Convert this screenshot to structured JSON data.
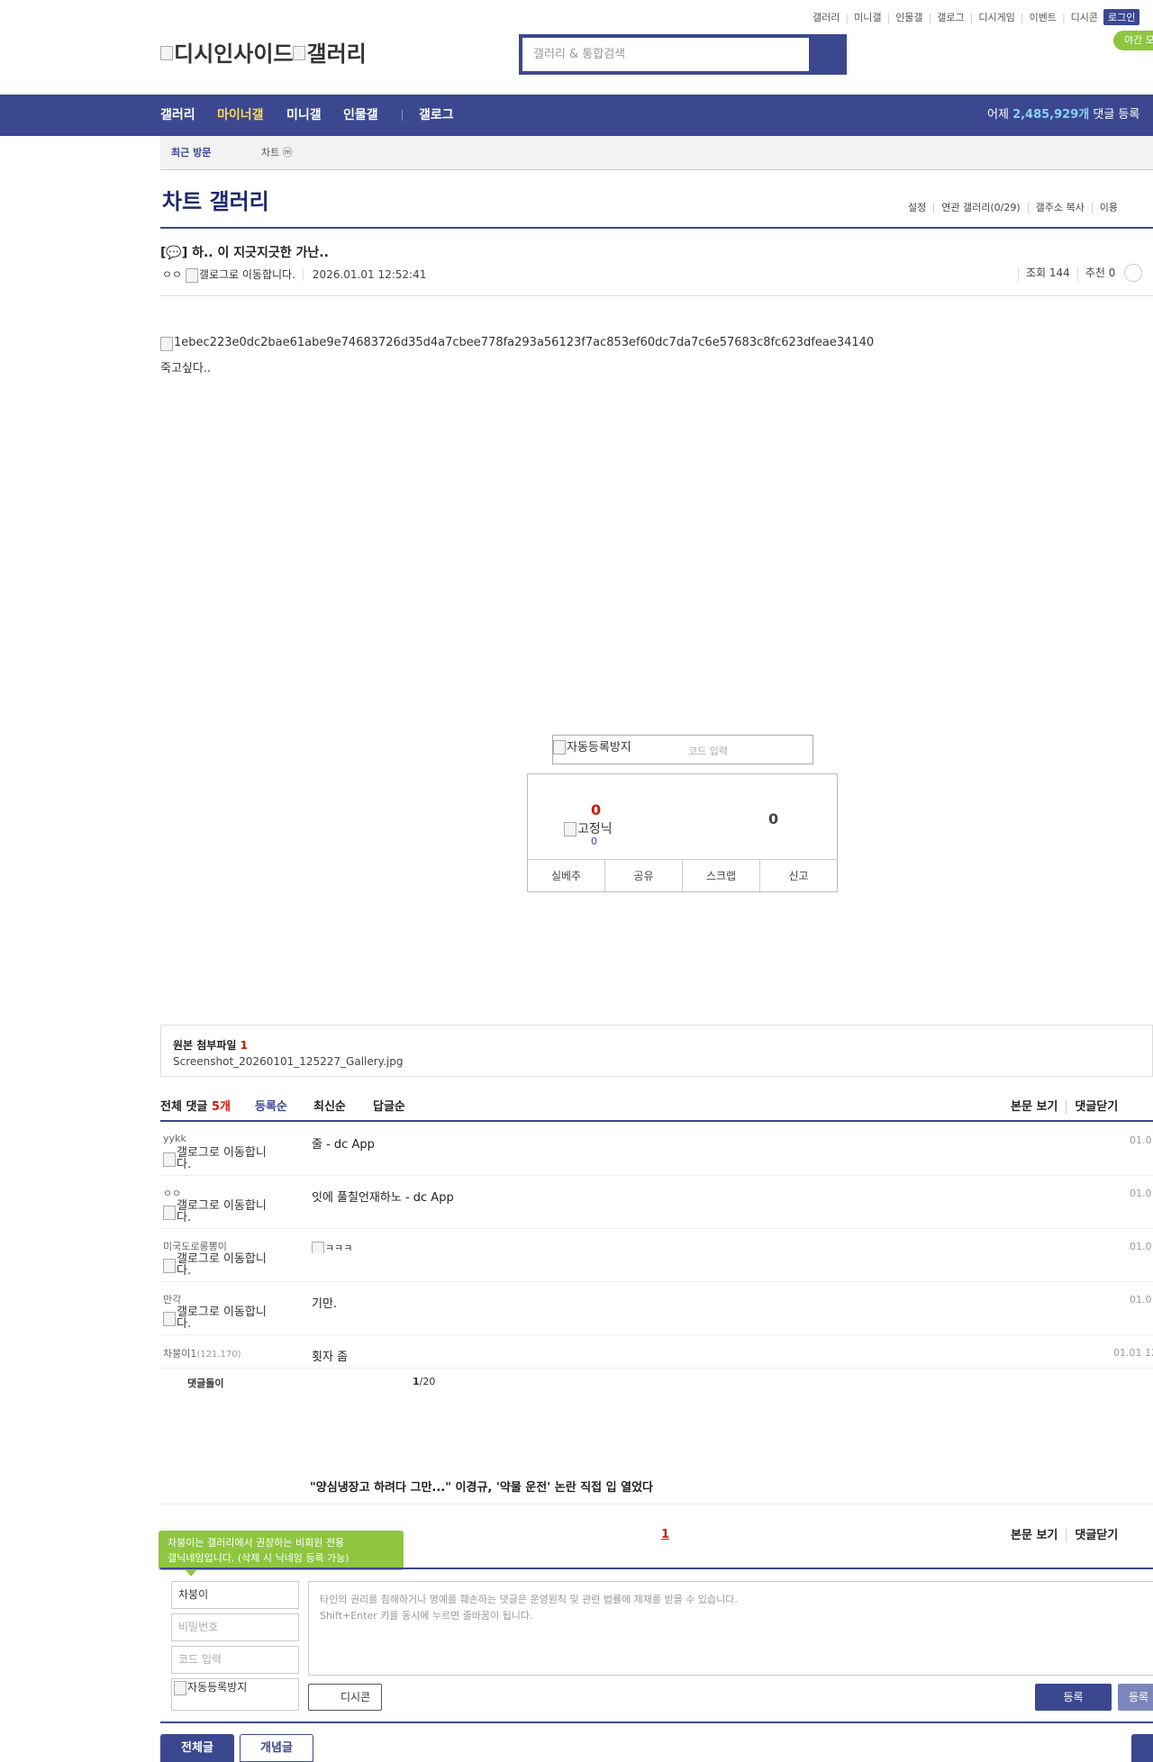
{
  "top_menu": [
    "갤러리",
    "미니갤",
    "인물갤",
    "갤로그",
    "디시게임",
    "이벤트",
    "디시콘"
  ],
  "login_label": "로그인",
  "night_mode_label": "야간 모",
  "logo_alt": "디시인사이드",
  "logo_alt2": "갤러리",
  "search_placeholder": "갤러리 & 통합검색",
  "gnb": {
    "items": [
      "갤러리",
      "마이너갤",
      "미니갤",
      "인물갤",
      "갤로그"
    ],
    "stat_prefix": "어제",
    "stat_value": "2,485,929개",
    "stat_suffix": "댓글 등록"
  },
  "recent": {
    "label": "최근 방문",
    "item": "차트 ⓜ"
  },
  "gallery": {
    "title": "차트 갤러리",
    "menu": [
      "설정",
      "연관 갤러리(0/29)",
      "갤주소 복사",
      "이용"
    ]
  },
  "post": {
    "title": "[💬] 하.. 이 지긋지긋한 가난..",
    "author": "ㅇㅇ",
    "author_icon_alt": "갤로그로 이동합니다.",
    "date": "2026.01.01 12:52:41",
    "views": "조회 144",
    "recommends": "추천 0",
    "image_alt": "1ebec223e0dc2bae61abe9e74683726d35d4a7cbee778fa293a56123f7ac853ef60dc7da7c6e57683c8fc623dfeae34140",
    "body": "죽고싶다.."
  },
  "captcha": {
    "img_alt": "자동등록방지",
    "placeholder": "코드 입력"
  },
  "recommend_box": {
    "up": "0",
    "fixed_alt": "고정닉",
    "fixed_count": "0",
    "down": "0",
    "buttons": [
      "실베추",
      "공유",
      "스크랩",
      "신고"
    ]
  },
  "attachment": {
    "label": "원본 첨부파일",
    "count": "1",
    "file": "Screenshot_20260101_125227_Gallery.jpg"
  },
  "comments": {
    "total_label": "전체 댓글",
    "total_count": "5개",
    "sort": [
      "등록순",
      "최신순",
      "답글순"
    ],
    "right_links": [
      "본문 보기",
      "댓글닫기"
    ],
    "items": [
      {
        "nick": "yykk",
        "icon": "갤로그로 이동합니다.",
        "text": "줄 - dc App",
        "date": "01.0"
      },
      {
        "nick": "ㅇㅇ",
        "icon": "갤로그로 이동합니다.",
        "text": "잇에 풀칠언재하노 - dc App",
        "date": "01.0"
      },
      {
        "nick": "미국도로롱뽕이",
        "icon": "갤로그로 이동합니다.",
        "text": "",
        "image_alt": "ㅋㅋㅋ",
        "date": "01.0"
      },
      {
        "nick": "만각",
        "icon": "갤로그로 이동합니다.",
        "text": "기만.",
        "date": "01.0"
      },
      {
        "nick": "차붕이1",
        "ip": "(121.170)",
        "text": "횟자 좀",
        "date": "01.01 12"
      }
    ],
    "dolgi_label": "댓글돌이",
    "page": "1",
    "page_total": "/20"
  },
  "news_headline": "\"양심냉장고 하려다 그만...\" 이경규, '약물 운전' 논란 직접 입 열었다",
  "pagination_current": "1",
  "writer": {
    "tooltip_line1": "차붕이는 갤러리에서 권장하는 비회원 전용",
    "tooltip_line2": "갤닉네임입니다. (삭제 시 닉네임 등록 가능)",
    "nickname": "차붕이",
    "password_placeholder": "비밀번호",
    "code_placeholder": "코드 입력",
    "captcha_alt": "자동등록방지",
    "textarea_line1": "타인의 권리를 침해하거나 명예를 훼손하는 댓글은 운영원칙 및 관련 법률에 제재를 받을 수 있습니다.",
    "textarea_line2": "Shift+Enter 키를 동시에 누르면 줄바꿈이 됩니다.",
    "dccon_label": "디시콘",
    "submit_label": "등록",
    "submit2_label": "등록"
  },
  "bottom_tabs": [
    "전체글",
    "개념글"
  ]
}
